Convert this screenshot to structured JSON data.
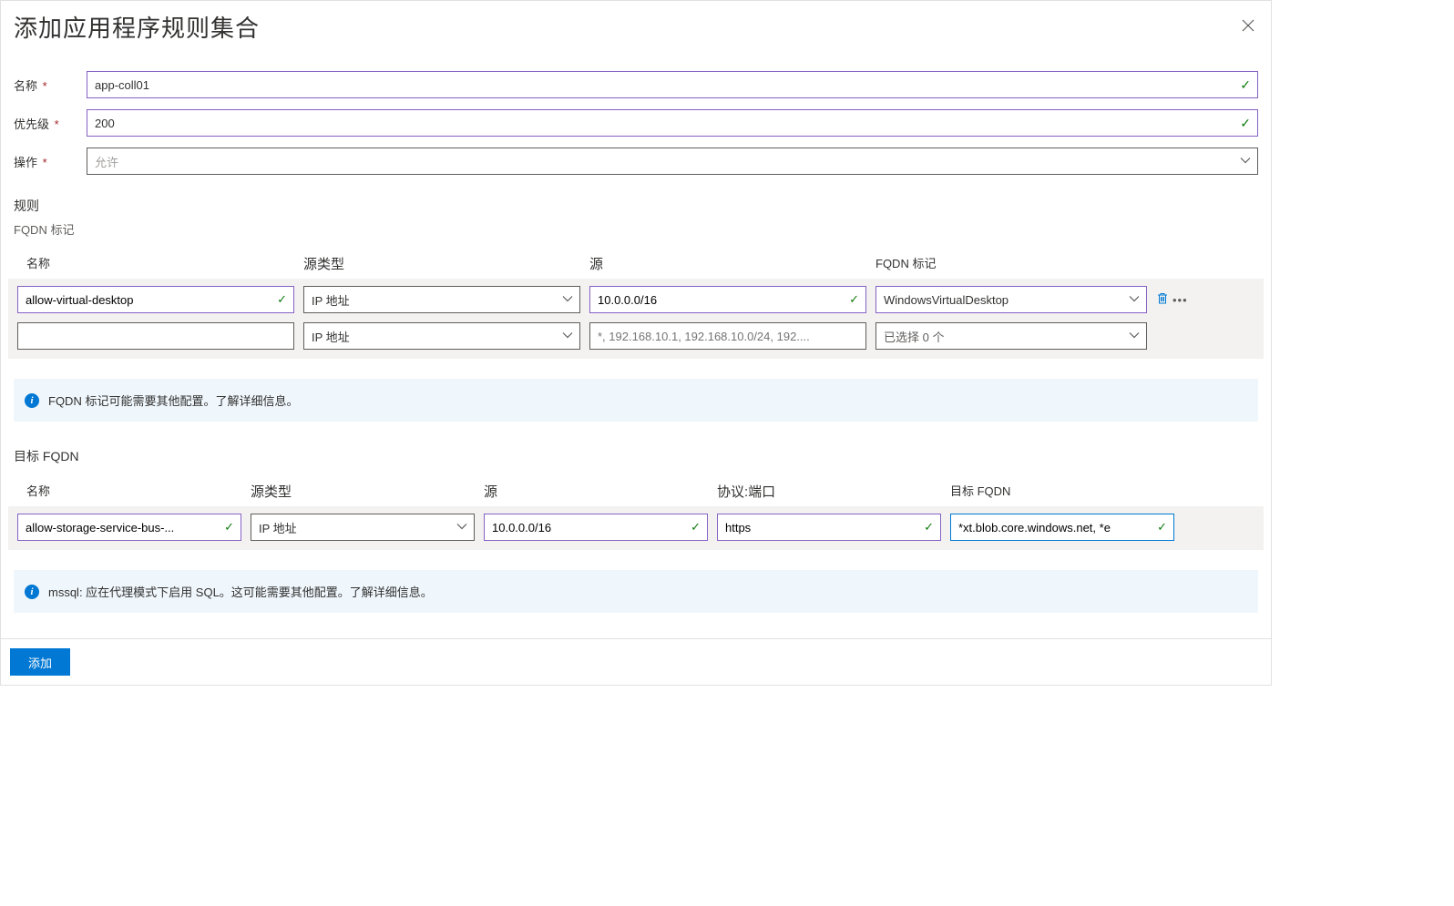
{
  "header": {
    "title": "添加应用程序规则集合"
  },
  "form": {
    "name_label": "名称",
    "name_value": "app-coll01",
    "priority_label": "优先级",
    "priority_value": "200",
    "action_label": "操作",
    "action_value": "允许"
  },
  "rules": {
    "section_label": "规则",
    "fqdn_tag_label": "FQDN 标记",
    "fqdn_cols": {
      "name": "名称",
      "src_type": "源类型",
      "src": "源",
      "fqdn_tag": "FQDN 标记"
    },
    "fqdn_rows": [
      {
        "name": "allow-virtual-desktop",
        "src_type": "IP 地址",
        "src": "10.0.0.0/16",
        "fqdn_tag": "WindowsVirtualDesktop",
        "has_check": true,
        "filled": true
      },
      {
        "name": "",
        "src_type": "IP 地址",
        "src_placeholder": "*, 192.168.10.1, 192.168.10.0/24, 192....",
        "fqdn_tag": "已选择 0 个",
        "filled": false
      }
    ],
    "fqdn_info": "FQDN 标记可能需要其他配置。了解详细信息。",
    "target_fqdn_label": "目标 FQDN",
    "target_cols": {
      "name": "名称",
      "src_type": "源类型",
      "src": "源",
      "proto": "协议:端口",
      "target": "目标 FQDN"
    },
    "target_rows": [
      {
        "name": "allow-storage-service-bus-...",
        "src_type": "IP 地址",
        "src": "10.0.0.0/16",
        "proto": "https",
        "target": "*xt.blob.core.windows.net, *e"
      }
    ],
    "target_info": "mssql: 应在代理模式下启用 SQL。这可能需要其他配置。了解详细信息。"
  },
  "footer": {
    "add_label": "添加"
  }
}
